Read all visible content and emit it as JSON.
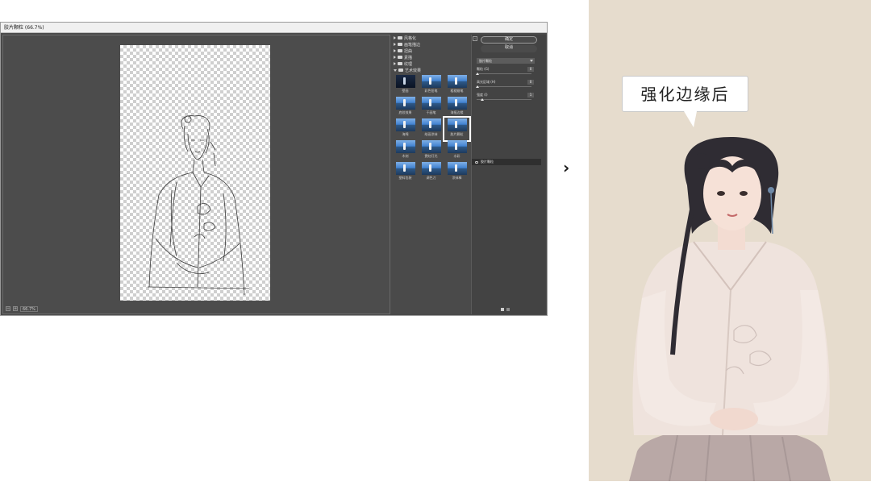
{
  "window": {
    "title": "胶片颗粒 (66.7%)",
    "zoom_value": "66.7%",
    "zoom_minus": "−",
    "zoom_plus": "+"
  },
  "filter_categories": [
    {
      "label": "风格化",
      "open": false
    },
    {
      "label": "画笔描边",
      "open": false
    },
    {
      "label": "扭曲",
      "open": false
    },
    {
      "label": "素描",
      "open": false
    },
    {
      "label": "纹理",
      "open": false
    },
    {
      "label": "艺术效果",
      "open": true
    }
  ],
  "filter_thumbs": [
    {
      "label": "壁画",
      "dark": true
    },
    {
      "label": "彩色铅笔",
      "dark": false
    },
    {
      "label": "粗糙蜡笔",
      "dark": false
    },
    {
      "label": "底纹效果",
      "dark": false
    },
    {
      "label": "干画笔",
      "dark": false
    },
    {
      "label": "海报边缘",
      "dark": false
    },
    {
      "label": "海绵",
      "dark": false
    },
    {
      "label": "绘画涂抹",
      "dark": false
    },
    {
      "label": "胶片颗粒",
      "dark": false,
      "selected": true
    },
    {
      "label": "木刻",
      "dark": false
    },
    {
      "label": "霓虹灯光",
      "dark": false
    },
    {
      "label": "水彩",
      "dark": false
    },
    {
      "label": "塑料包装",
      "dark": false
    },
    {
      "label": "调色刀",
      "dark": false
    },
    {
      "label": "涂抹棒",
      "dark": false
    }
  ],
  "settings": {
    "ok_label": "确定",
    "cancel_label": "取消",
    "filter_select": "胶片颗粒",
    "params": [
      {
        "label": "颗粒 (G)",
        "value": "0",
        "fraction": 0.02
      },
      {
        "label": "高光区域 (H)",
        "value": "0",
        "fraction": 0.02
      },
      {
        "label": "强度 (I)",
        "value": "1",
        "fraction": 0.1
      }
    ],
    "layer_name": "胶片颗粒"
  },
  "separator": "›",
  "result": {
    "caption": "强化边缘后"
  },
  "colors": {
    "panel_bg": "#4a4a4a",
    "photo_bg": "#e6dccd"
  }
}
